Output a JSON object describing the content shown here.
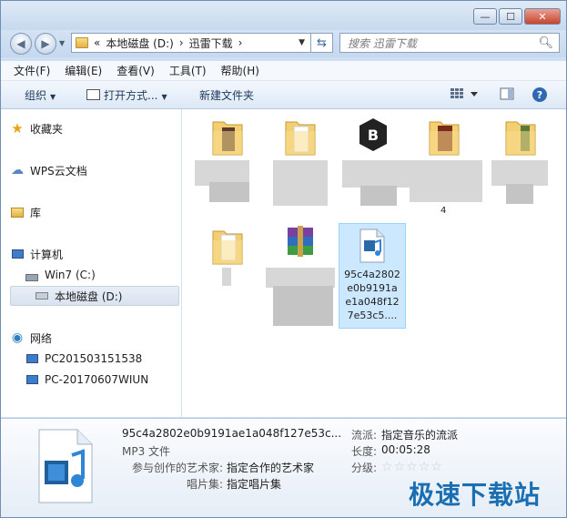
{
  "window": {
    "minimize": "—",
    "maximize": "☐",
    "close": "✕"
  },
  "address": {
    "crumbs": [
      "«",
      "本地磁盘 (D:)",
      "›",
      "迅雷下载",
      "›"
    ],
    "search_placeholder": "搜索 迅雷下载"
  },
  "menu": [
    "文件(F)",
    "编辑(E)",
    "查看(V)",
    "工具(T)",
    "帮助(H)"
  ],
  "toolbar": {
    "organize": "组织",
    "open_with": "打开方式...",
    "new_folder": "新建文件夹"
  },
  "sidebar": {
    "favorites": "收藏夹",
    "wps": "WPS云文档",
    "library": "库",
    "computer": "计算机",
    "drive_c": "Win7 (C:)",
    "drive_d": "本地磁盘 (D:)",
    "network": "网络",
    "pc1": "PC201503151538",
    "pc2": "PC-20170607WIUN"
  },
  "content": {
    "partial_label": "4",
    "selected_file_lines": [
      "95c4a2802",
      "e0b9191a",
      "e1a048f12",
      "7e53c5...."
    ]
  },
  "details": {
    "file_name": "95c4a2802e0b9191ae1a048f127e53c...",
    "file_type": "MP3 文件",
    "artists_label": "参与创作的艺术家:",
    "artists_value": "指定合作的艺术家",
    "album_label": "唱片集:",
    "album_value": "指定唱片集",
    "genre_label": "流派:",
    "genre_value": "指定音乐的流派",
    "length_label": "长度:",
    "length_value": "00:05:28",
    "rating_label": "分级:",
    "rating": 0,
    "rating_max": 5
  },
  "watermark": "极速下载站",
  "colors": {
    "selection": "#cce8ff",
    "watermark": "#1a6fb3",
    "window_frame": "#cfe0f2"
  }
}
